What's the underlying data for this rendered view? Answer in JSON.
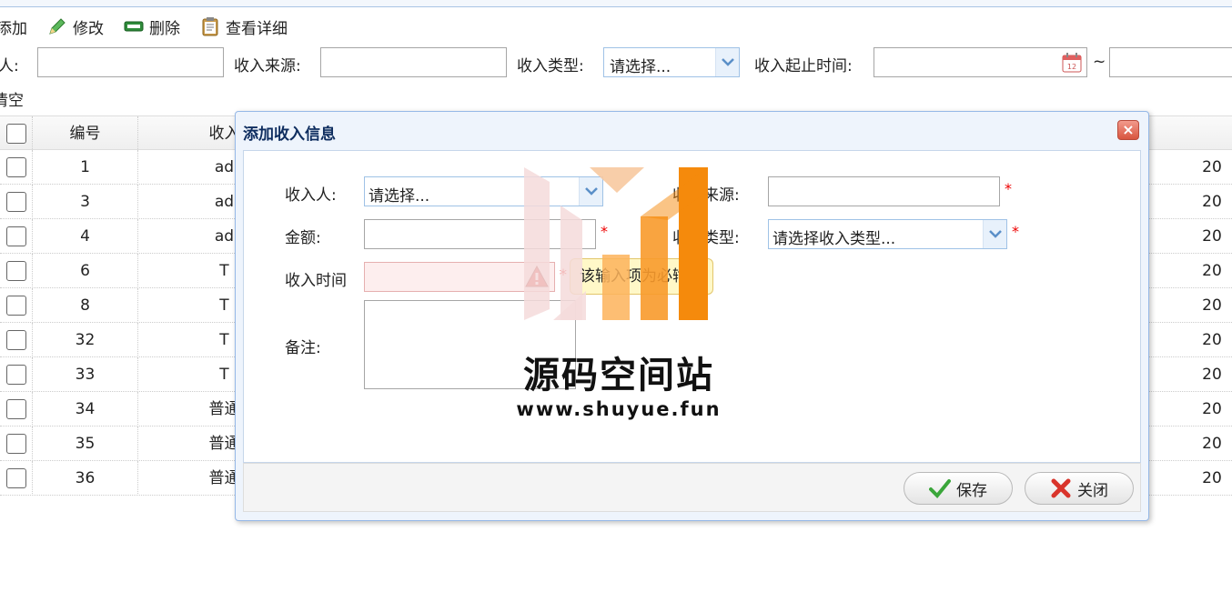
{
  "toolbar": {
    "add": "添加",
    "edit": "修改",
    "delete": "删除",
    "detail": "查看详细"
  },
  "filters": {
    "person_label": "人:",
    "source_label": "收入来源:",
    "type_label": "收入类型:",
    "type_value": "请选择...",
    "time_label": "收入起止时间:",
    "tilde": "~",
    "clear": "清空"
  },
  "grid": {
    "headers": {
      "id": "编号",
      "name": "收入"
    },
    "rows": [
      {
        "id": "1",
        "name": "ad",
        "last": "20"
      },
      {
        "id": "3",
        "name": "ad",
        "last": "20"
      },
      {
        "id": "4",
        "name": "ad",
        "last": "20"
      },
      {
        "id": "6",
        "name": "T",
        "last": "20"
      },
      {
        "id": "8",
        "name": "T",
        "last": "20"
      },
      {
        "id": "32",
        "name": "T",
        "last": "20"
      },
      {
        "id": "33",
        "name": "T",
        "last": "20"
      },
      {
        "id": "34",
        "name": "普通",
        "last": "20"
      },
      {
        "id": "35",
        "name": "普通",
        "last": "20"
      },
      {
        "id": "36",
        "name": "普通",
        "last": "20"
      }
    ]
  },
  "dialog": {
    "title": "添加收入信息",
    "close": "×",
    "person_label": "收入人:",
    "person_value": "请选择...",
    "source_label": "收入来源:",
    "amount_label": "金额:",
    "type_label": "收入类型:",
    "type_value": "请选择收入类型...",
    "time_label": "收入时间",
    "tip": "该输入项为必输项",
    "note_label": "备注:",
    "required": "*",
    "save": "保存",
    "closebtn": "关闭"
  },
  "watermark": {
    "name": "源码空间站",
    "url": "www.shuyue.fun"
  }
}
